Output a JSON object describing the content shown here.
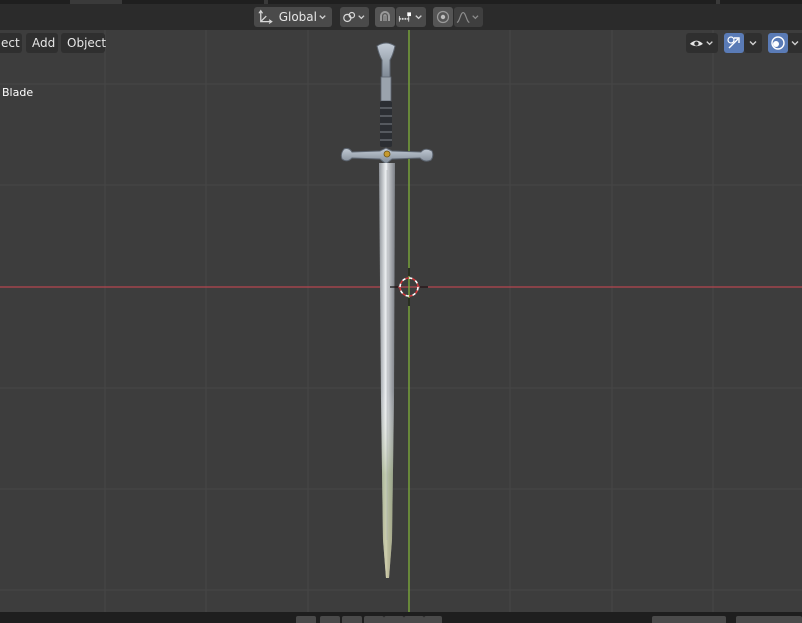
{
  "header": {
    "transform_orientation": "Global"
  },
  "viewport_menu": {
    "items": [
      {
        "label": "ect"
      },
      {
        "label": "Add"
      },
      {
        "label": "Object"
      }
    ]
  },
  "viewport": {
    "active_object_name": "Blade"
  },
  "icons": {
    "orientation": "transform-orientation-icon",
    "pivot": "pivot-point-icon",
    "snap": "snap-magnet-icon",
    "snap_increment": "snap-increment-icon",
    "proportional": "proportional-editing-icon",
    "falloff": "falloff-curve-icon",
    "visibility": "object-visibility-eye-icon",
    "gizmo": "gizmo-toggle-icon",
    "overlay": "overlay-toggle-icon",
    "cursor": "3d-cursor-icon"
  },
  "colors": {
    "x_axis": "#b5454f",
    "y_axis": "#7fb03a",
    "accent": "#5a7bb6",
    "grid": "#474747",
    "background": "#3d3d3d"
  }
}
